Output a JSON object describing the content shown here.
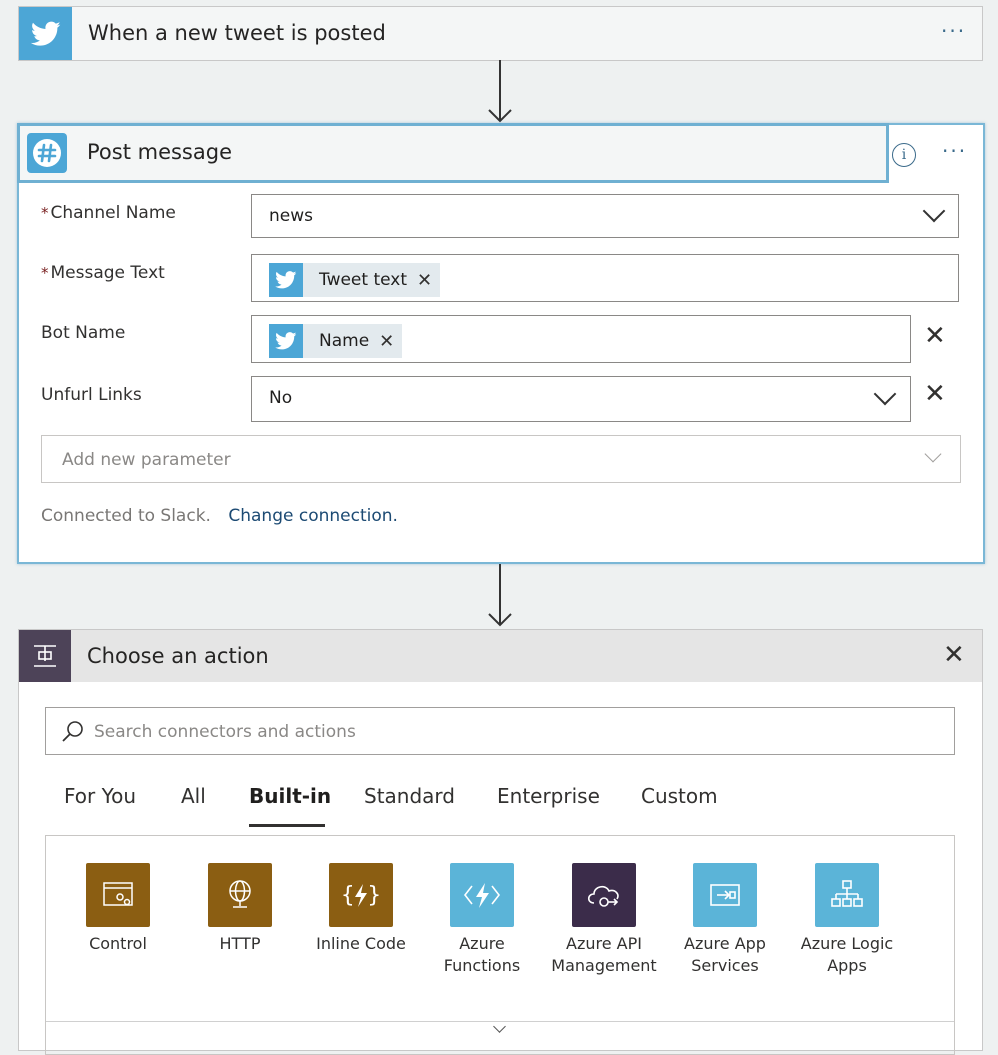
{
  "colors": {
    "twitter": "#4ca6d6",
    "slack_accent": "#6fb0d2",
    "control": "#8b5e12",
    "api_mgmt": "#3b2c4a",
    "azure_blue": "#5bb4d8",
    "link": "#1c4a73"
  },
  "trigger": {
    "title": "When a new tweet is posted",
    "icon": "twitter-icon",
    "more": "···"
  },
  "post": {
    "title": "Post message",
    "icon": "slack-icon",
    "more": "···",
    "info": "i",
    "fields": {
      "channel": {
        "label": "Channel Name",
        "required": "*",
        "value": "news"
      },
      "message": {
        "label": "Message Text",
        "required": "*",
        "token": "Tweet text"
      },
      "bot": {
        "label": "Bot Name",
        "token": "Name"
      },
      "unfurl": {
        "label": "Unfurl Links",
        "value": "No"
      }
    },
    "add_param": "Add new parameter",
    "connected": "Connected to Slack.",
    "change": "Change connection."
  },
  "choose": {
    "title": "Choose an action",
    "search_placeholder": "Search connectors and actions",
    "tabs": [
      "For You",
      "All",
      "Built-in",
      "Standard",
      "Enterprise",
      "Custom"
    ],
    "active_tab": "Built-in",
    "tiles": [
      {
        "line1": "Control",
        "line2": "",
        "icon": "control-icon"
      },
      {
        "line1": "HTTP",
        "line2": "",
        "icon": "globe-icon"
      },
      {
        "line1": "Inline Code",
        "line2": "",
        "icon": "code-icon"
      },
      {
        "line1": "Azure",
        "line2": "Functions",
        "icon": "functions-icon"
      },
      {
        "line1": "Azure API",
        "line2": "Management",
        "icon": "api-cloud-icon"
      },
      {
        "line1": "Azure App",
        "line2": "Services",
        "icon": "app-service-icon"
      },
      {
        "line1": "Azure Logic",
        "line2": "Apps",
        "icon": "logic-apps-icon"
      }
    ]
  }
}
